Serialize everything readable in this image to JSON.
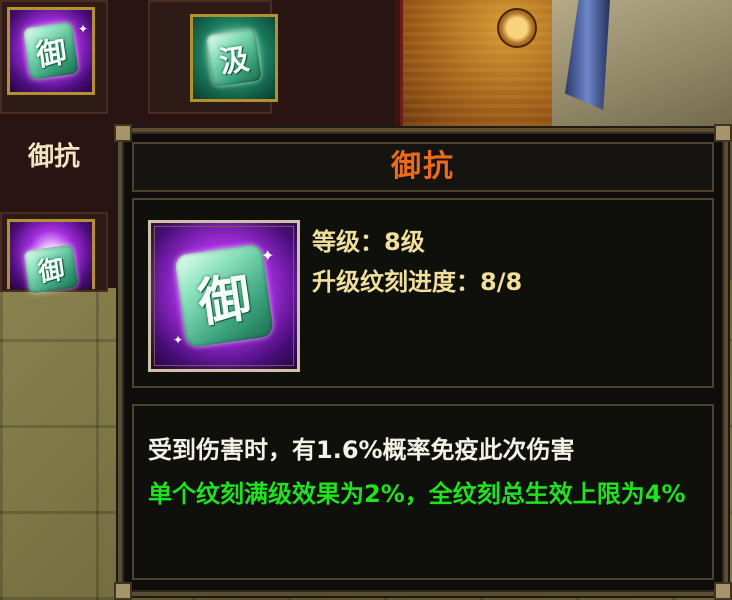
{
  "inventory": {
    "slots": [
      {
        "glyph": "御",
        "style": "purple",
        "label": "御抗"
      },
      {
        "glyph": "汲",
        "style": "green"
      },
      {
        "glyph": "御",
        "style": "purple"
      }
    ]
  },
  "tooltip": {
    "title": "御抗",
    "icon_glyph": "御",
    "level": "等级：8级",
    "progress": "升级纹刻进度：8/8",
    "progress_value": {
      "current": 8,
      "max": 8
    },
    "description": "受到伤害时，有1.6%概率免疫此次伤害",
    "bonus": "单个纹刻满级效果为2%，全纹刻总生效上限为4%"
  },
  "colors": {
    "title": "#ec6a1a",
    "level_text": "#f1df9c",
    "description_text": "#f4f1e6",
    "bonus_text": "#1fe31f"
  }
}
